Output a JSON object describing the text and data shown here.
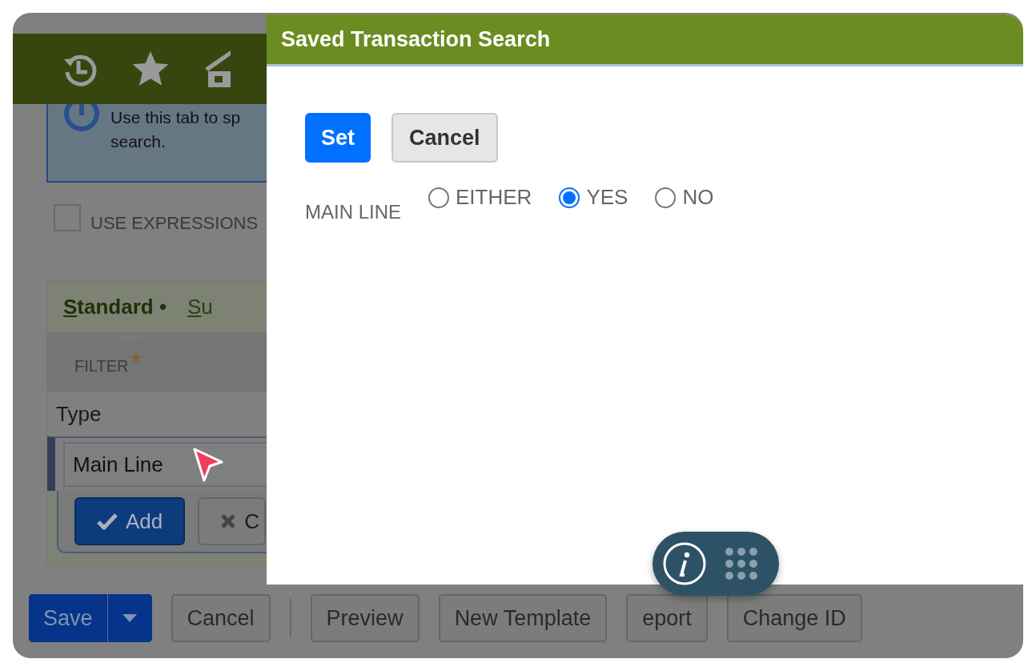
{
  "info_box": {
    "lines": [
      "Use this tab to sp",
      "search."
    ]
  },
  "use_expressions": {
    "label": "USE EXPRESSIONS",
    "checked": false
  },
  "tabs": [
    {
      "label": "Standard",
      "marker": "•",
      "selected": true
    },
    {
      "label": "Su",
      "selected": false
    }
  ],
  "filter": {
    "header": "FILTER",
    "required_mark": "*",
    "type_label": "Type",
    "value": "Main Line",
    "buttons": [
      {
        "label": "Add",
        "kind": "primary"
      },
      {
        "label": "C",
        "kind": "secondary"
      }
    ]
  },
  "footer_buttons": [
    {
      "label": "Save",
      "kind": "split"
    },
    {
      "label": "Cancel",
      "kind": "plain"
    },
    {
      "kind": "separator"
    },
    {
      "label": "Preview",
      "kind": "plain"
    },
    {
      "label": "New Template",
      "kind": "plain"
    },
    {
      "label": "eport",
      "kind": "plain"
    },
    {
      "label": "Change ID",
      "kind": "plain"
    }
  ],
  "dialog": {
    "title": "Saved Transaction Search",
    "buttons": [
      {
        "label": "Set",
        "kind": "primary"
      },
      {
        "label": "Cancel",
        "kind": "secondary"
      }
    ],
    "field": {
      "label": "MAIN LINE",
      "options": [
        {
          "label": "EITHER",
          "selected": false
        },
        {
          "label": "YES",
          "selected": true
        },
        {
          "label": "NO",
          "selected": false
        }
      ]
    }
  }
}
